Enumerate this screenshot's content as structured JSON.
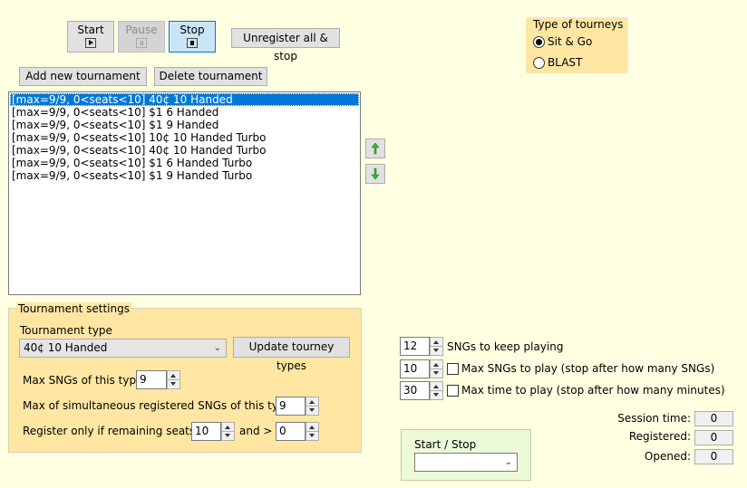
{
  "controls": {
    "start_label": "Start",
    "pause_label": "Pause",
    "stop_label": "Stop",
    "unregister_label": "Unregister all & stop"
  },
  "tourney_type_group": {
    "title": "Type of tourneys",
    "options": [
      {
        "label": "Sit & Go",
        "selected": true
      },
      {
        "label": "BLAST",
        "selected": false
      }
    ]
  },
  "list_actions": {
    "add_label": "Add new tournament",
    "delete_label": "Delete tournament"
  },
  "tournaments": [
    "[max=9/9, 0<seats<10] 40¢ 10 Handed",
    "[max=9/9, 0<seats<10] $1 6 Handed",
    "[max=9/9, 0<seats<10] $1 9 Handed",
    "[max=9/9, 0<seats<10] 10¢ 10 Handed Turbo",
    "[max=9/9, 0<seats<10] 40¢ 10 Handed Turbo",
    "[max=9/9, 0<seats<10] $1 6 Handed Turbo",
    "[max=9/9, 0<seats<10] $1 9 Handed Turbo"
  ],
  "settings": {
    "title": "Tournament settings",
    "type_label": "Tournament type",
    "type_value": "40¢ 10 Handed",
    "update_label": "Update tourney types",
    "max_sngs_label": "Max SNGs of this type",
    "max_sngs_value": "9",
    "max_simul_label": "Max of simultaneous registered SNGs of this type",
    "max_simul_value": "9",
    "register_label": "Register only if remaining seats <",
    "register_lt_value": "10",
    "and_label": "and >",
    "register_gt_value": "0"
  },
  "global": {
    "keep_playing_value": "12",
    "keep_playing_label": "SNGs to keep playing",
    "max_play_value": "10",
    "max_play_label": "Max SNGs to play (stop after how many SNGs)",
    "max_time_value": "30",
    "max_time_label": "Max time to play (stop after how many minutes)"
  },
  "start_stop": {
    "title": "Start / Stop",
    "value": ""
  },
  "stats": {
    "session_label": "Session time:",
    "session_value": "0",
    "registered_label": "Registered:",
    "registered_value": "0",
    "opened_label": "Opened:",
    "opened_value": "0"
  }
}
